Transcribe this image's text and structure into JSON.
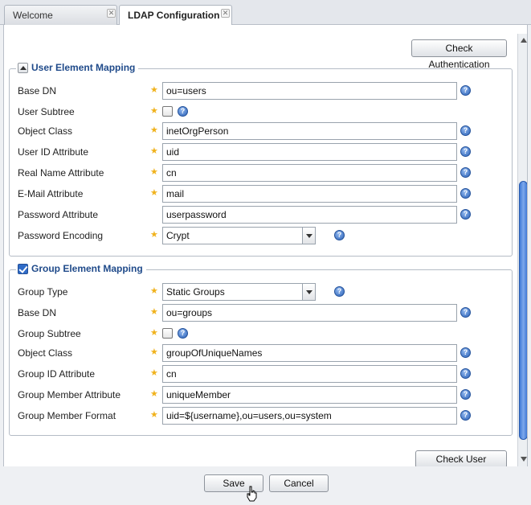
{
  "tabs": [
    {
      "label": "Welcome",
      "active": false
    },
    {
      "label": "LDAP Configuration",
      "active": true
    }
  ],
  "buttons": {
    "check_authentication": "Check Authentication",
    "check_user_mapping": "Check User Mapping",
    "save": "Save",
    "cancel": "Cancel"
  },
  "required_marker": "★",
  "help_glyph": "?",
  "user_mapping": {
    "legend": "User Element Mapping",
    "fields": {
      "base_dn": {
        "label": "Base DN",
        "value": "ou=users"
      },
      "user_subtree": {
        "label": "User Subtree",
        "checked": false
      },
      "object_class": {
        "label": "Object Class",
        "value": "inetOrgPerson"
      },
      "user_id_attribute": {
        "label": "User ID Attribute",
        "value": "uid"
      },
      "real_name_attribute": {
        "label": "Real Name Attribute",
        "value": "cn"
      },
      "email_attribute": {
        "label": "E-Mail Attribute",
        "value": "mail"
      },
      "password_attribute": {
        "label": "Password Attribute",
        "value": "userpassword"
      },
      "password_encoding": {
        "label": "Password Encoding",
        "value": "Crypt"
      }
    }
  },
  "group_mapping": {
    "legend": "Group Element Mapping",
    "enabled": true,
    "fields": {
      "group_type": {
        "label": "Group Type",
        "value": "Static Groups"
      },
      "base_dn": {
        "label": "Base DN",
        "value": "ou=groups"
      },
      "group_subtree": {
        "label": "Group Subtree",
        "checked": false
      },
      "object_class": {
        "label": "Object Class",
        "value": "groupOfUniqueNames"
      },
      "group_id_attribute": {
        "label": "Group ID Attribute",
        "value": "cn"
      },
      "group_member_attribute": {
        "label": "Group Member Attribute",
        "value": "uniqueMember"
      },
      "group_member_format": {
        "label": "Group Member Format",
        "value": "uid=${username},ou=users,ou=system"
      }
    }
  },
  "colors": {
    "legend": "#1f4a8a",
    "required": "#f0b21c",
    "help": "#2c63b8",
    "scroll_thumb": "#3f79d6"
  }
}
